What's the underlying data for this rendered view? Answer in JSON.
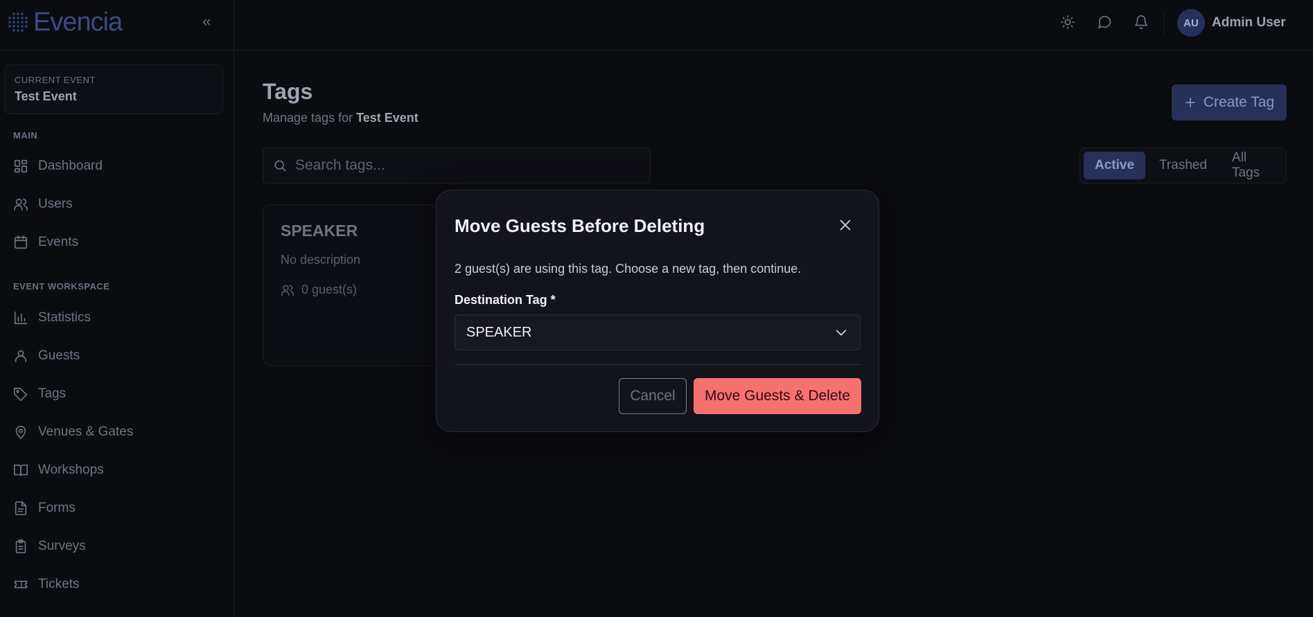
{
  "app": {
    "brand": "Evencia"
  },
  "sidebar": {
    "current_event_label": "CURRENT EVENT",
    "current_event": "Test Event",
    "sections": [
      {
        "label": "MAIN",
        "items": [
          {
            "label": "Dashboard",
            "icon": "dashboard-icon"
          },
          {
            "label": "Users",
            "icon": "users-icon"
          },
          {
            "label": "Events",
            "icon": "calendar-icon"
          }
        ]
      },
      {
        "label": "EVENT WORKSPACE",
        "items": [
          {
            "label": "Statistics",
            "icon": "chart-icon"
          },
          {
            "label": "Guests",
            "icon": "user-icon"
          },
          {
            "label": "Tags",
            "icon": "tag-icon"
          },
          {
            "label": "Venues & Gates",
            "icon": "map-pin-icon"
          },
          {
            "label": "Workshops",
            "icon": "book-icon"
          },
          {
            "label": "Forms",
            "icon": "file-icon"
          },
          {
            "label": "Surveys",
            "icon": "clipboard-icon"
          },
          {
            "label": "Tickets",
            "icon": "ticket-icon"
          }
        ]
      }
    ]
  },
  "topbar": {
    "avatar_initials": "AU",
    "user_name": "Admin User"
  },
  "page": {
    "title": "Tags",
    "subtitle_prefix": "Manage tags for",
    "subtitle_event": "Test Event",
    "create_button": "Create Tag",
    "search_placeholder": "Search tags...",
    "filters": [
      {
        "label": "Active",
        "active": true
      },
      {
        "label": "Trashed",
        "active": false
      },
      {
        "label": "All Tags",
        "active": false
      }
    ]
  },
  "tags": [
    {
      "name": "SPEAKER",
      "description": "No description",
      "guests": "0 guest(s)"
    }
  ],
  "modal": {
    "title": "Move Guests Before Deleting",
    "message": "2 guest(s) are using this tag. Choose a new tag, then continue.",
    "field_label": "Destination Tag *",
    "selected_value": "SPEAKER",
    "cancel_label": "Cancel",
    "confirm_label": "Move Guests & Delete"
  },
  "colors": {
    "background": "#0b0c10",
    "accent": "#283057",
    "danger": "#f87171"
  }
}
